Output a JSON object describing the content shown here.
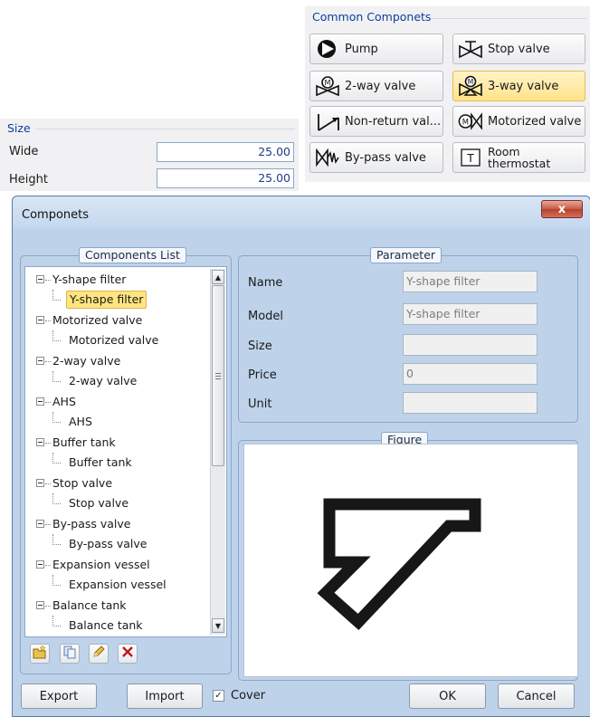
{
  "common": {
    "title": "Common Componets",
    "buttons": [
      {
        "label": "Pump",
        "icon": "pump-icon"
      },
      {
        "label": "Stop valve",
        "icon": "stop-valve-icon"
      },
      {
        "label": "2-way valve",
        "icon": "two-way-valve-icon"
      },
      {
        "label": "3-way valve",
        "icon": "three-way-valve-icon",
        "selected": true
      },
      {
        "label": "Non-return val...",
        "icon": "non-return-valve-icon"
      },
      {
        "label": "Motorized valve",
        "icon": "motorized-valve-icon"
      },
      {
        "label": "By-pass valve",
        "icon": "bypass-valve-icon"
      },
      {
        "label_line1": "Room",
        "label_line2": "thermostat",
        "icon": "room-thermostat-icon"
      }
    ]
  },
  "size": {
    "title": "Size",
    "wide_label": "Wide",
    "wide_value": "25.00",
    "height_label": "Height",
    "height_value": "25.00"
  },
  "dialog": {
    "title": "Componets",
    "close_glyph": "x",
    "components_list": {
      "title": "Components List",
      "groups": [
        {
          "name": "Y-shape filter",
          "child": "Y-shape filter",
          "selected": true
        },
        {
          "name": "Motorized valve",
          "child": "Motorized valve"
        },
        {
          "name": "2-way valve",
          "child": "2-way valve"
        },
        {
          "name": "AHS",
          "child": "AHS"
        },
        {
          "name": "Buffer tank",
          "child": "Buffer tank"
        },
        {
          "name": "Stop valve",
          "child": "Stop valve"
        },
        {
          "name": "By-pass valve",
          "child": "By-pass valve"
        },
        {
          "name": "Expansion vessel",
          "child": "Expansion vessel"
        },
        {
          "name": "Balance tank",
          "child": "Balance tank"
        }
      ],
      "tools": [
        "new-folder-icon",
        "copy-icon",
        "edit-pencil-icon",
        "delete-icon"
      ]
    },
    "parameter": {
      "title": "Parameter",
      "name_label": "Name",
      "name_value": "Y-shape filter",
      "model_label": "Model",
      "model_value": "Y-shape filter",
      "size_label": "Size",
      "size_value": "",
      "price_label": "Price",
      "price_value": "0",
      "unit_label": "Unit",
      "unit_value": ""
    },
    "figure": {
      "title": "Figure",
      "image": "y-shape-filter-symbol"
    },
    "footer": {
      "export_label": "Export",
      "import_label": "Import",
      "cover_label": "Cover",
      "cover_checked": true,
      "ok_label": "OK",
      "cancel_label": "Cancel"
    }
  },
  "colors": {
    "accent_title": "#0a3f9c",
    "selection": "#ffe580",
    "dialog_frame": "#bed3ea"
  }
}
